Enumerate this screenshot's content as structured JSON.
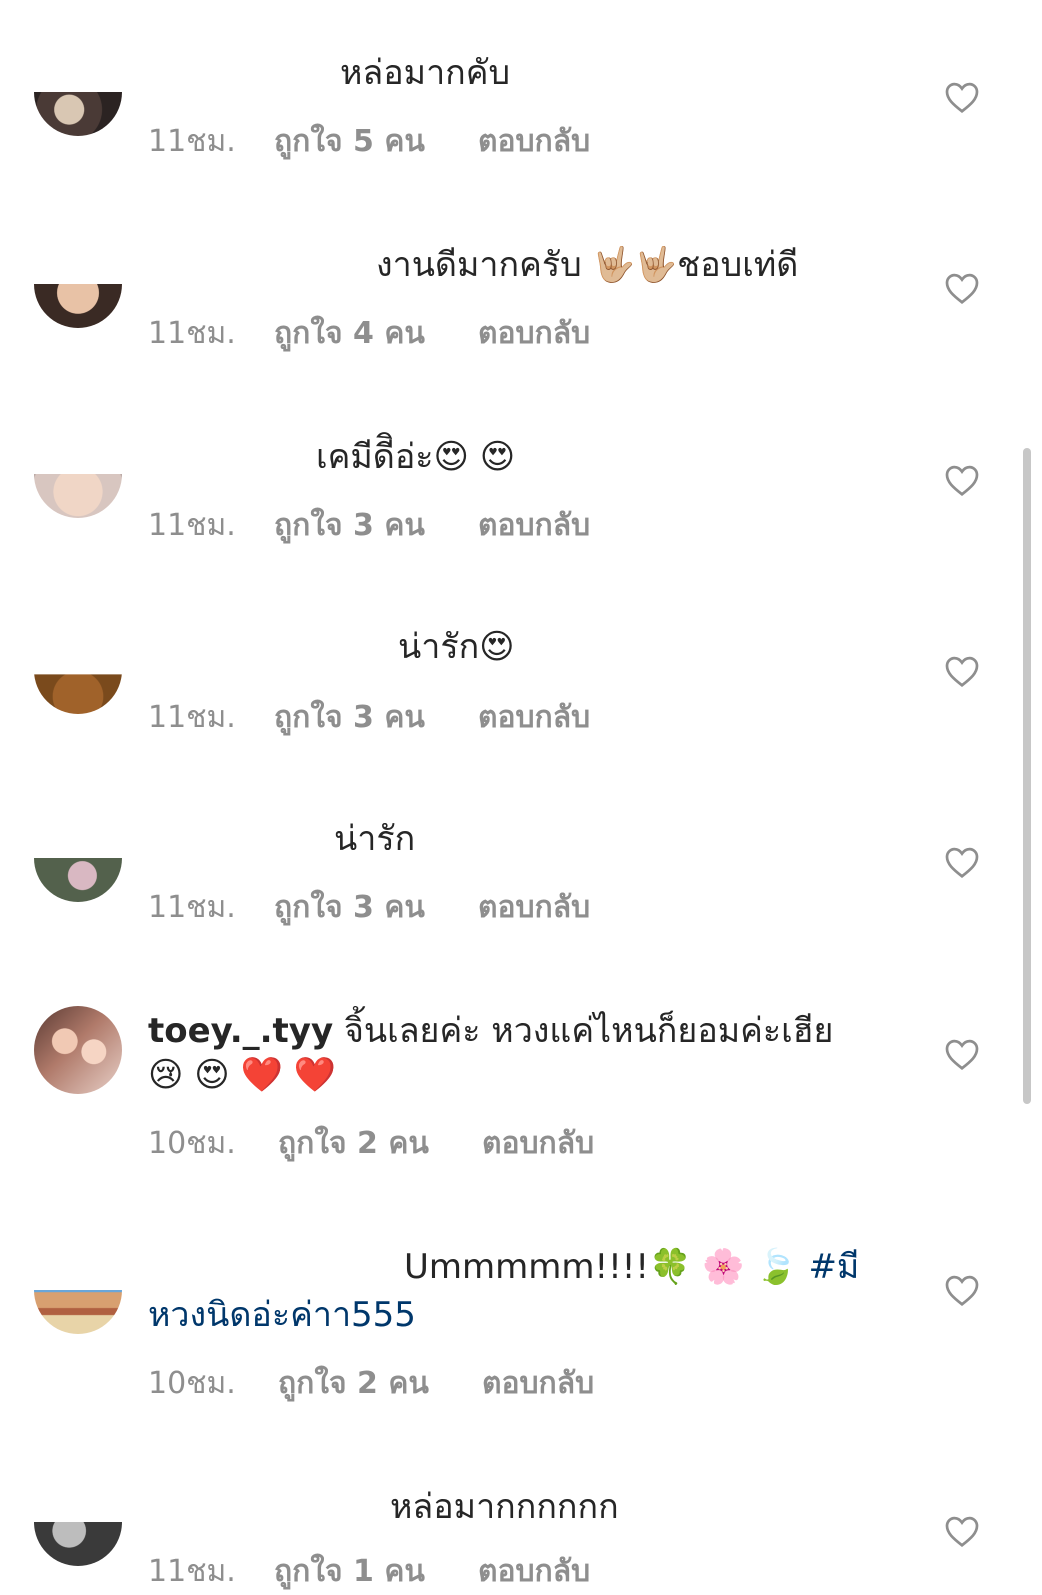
{
  "comments": [
    {
      "text": "หล่อมากคับ",
      "time": "11ชม.",
      "likes": "ถูกใจ 5 คน",
      "reply": "ตอบกลับ"
    },
    {
      "text": "งานดีมากครับ 🤟🏼🤟🏼ชอบเท่ดี",
      "time": "11ชม.",
      "likes": "ถูกใจ 4 คน",
      "reply": "ตอบกลับ"
    },
    {
      "text": "เคมีดีิอ่ะ😍 😍",
      "time": "11ชม.",
      "likes": "ถูกใจ 3 คน",
      "reply": "ตอบกลับ"
    },
    {
      "text": "น่ารัก😍",
      "time": "11ชม.",
      "likes": "ถูกใจ 3 คน",
      "reply": "ตอบกลับ"
    },
    {
      "text": "น่ารัก",
      "time": "11ชม.",
      "likes": "ถูกใจ 3 คน",
      "reply": "ตอบกลับ"
    },
    {
      "username": "toey._.tyy",
      "text": "จิ้นเลยค่ะ หวงแค่ไหนก็ยอมค่ะเฮีย",
      "text2": "😢 😍 ❤️ ❤️",
      "time": "10ชม.",
      "likes": "ถูกใจ 2 คน",
      "reply": "ตอบกลับ"
    },
    {
      "text": "Ummmmm!!!!🍀 🌸 🍃 ",
      "hashtag": "#มี",
      "text2": "หวงนิดอ่ะค่าา555",
      "time": "10ชม.",
      "likes": "ถูกใจ 2 คน",
      "reply": "ตอบกลับ"
    },
    {
      "text": "หล่อมากกกกกก",
      "time": "11ชม.",
      "likes": "ถูกใจ 1 คน",
      "reply": "ตอบกลับ"
    }
  ],
  "icons": {
    "like": "heart-outline-icon"
  },
  "colors": {
    "meta": "#8e8e8e",
    "hashtag": "#00376b",
    "text": "#262626"
  }
}
